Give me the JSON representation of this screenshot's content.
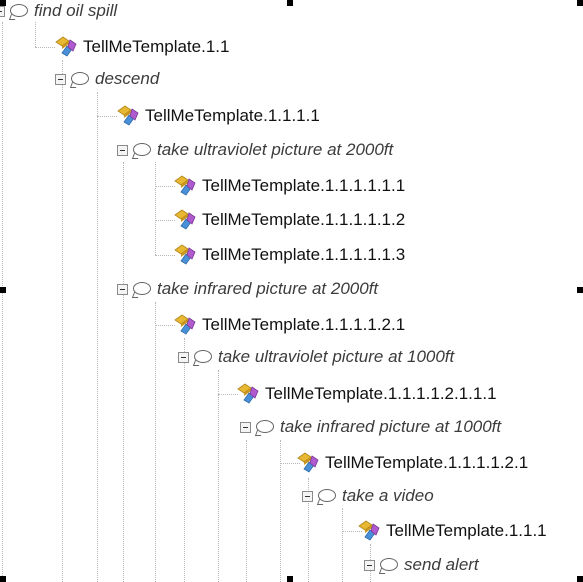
{
  "tree": [
    {
      "type": "task",
      "label": "find oil spill"
    },
    {
      "type": "template",
      "label": "TellMeTemplate.1.1"
    },
    {
      "type": "task",
      "label": "descend"
    },
    {
      "type": "template",
      "label": "TellMeTemplate.1.1.1.1"
    },
    {
      "type": "task",
      "label": "take ultraviolet picture at 2000ft"
    },
    {
      "type": "template",
      "label": "TellMeTemplate.1.1.1.1.1.1"
    },
    {
      "type": "template",
      "label": "TellMeTemplate.1.1.1.1.1.2"
    },
    {
      "type": "template",
      "label": "TellMeTemplate.1.1.1.1.1.3"
    },
    {
      "type": "task",
      "label": "take infrared picture at 2000ft"
    },
    {
      "type": "template",
      "label": "TellMeTemplate.1.1.1.1.2.1"
    },
    {
      "type": "task",
      "label": "take ultraviolet picture at 1000ft"
    },
    {
      "type": "template",
      "label": "TellMeTemplate.1.1.1.1.2.1.1.1"
    },
    {
      "type": "task",
      "label": "take infrared picture at 1000ft"
    },
    {
      "type": "template",
      "label": "TellMeTemplate.1.1.1.1.2.1"
    },
    {
      "type": "task",
      "label": "take a video"
    },
    {
      "type": "template",
      "label": "TellMeTemplate.1.1.1"
    },
    {
      "type": "task",
      "label": "send alert"
    }
  ],
  "icons": {
    "task": "speech-bubble-icon",
    "template": "template-icon",
    "toggle": "collapse-toggle-icon"
  },
  "colors": {
    "task_text": "#3c3c3c",
    "template_text": "#111111",
    "connector": "#b8b8b8",
    "template_icon_gold": "#e8b832",
    "template_icon_blue": "#4a90d9",
    "template_icon_purple": "#b05ad0"
  }
}
